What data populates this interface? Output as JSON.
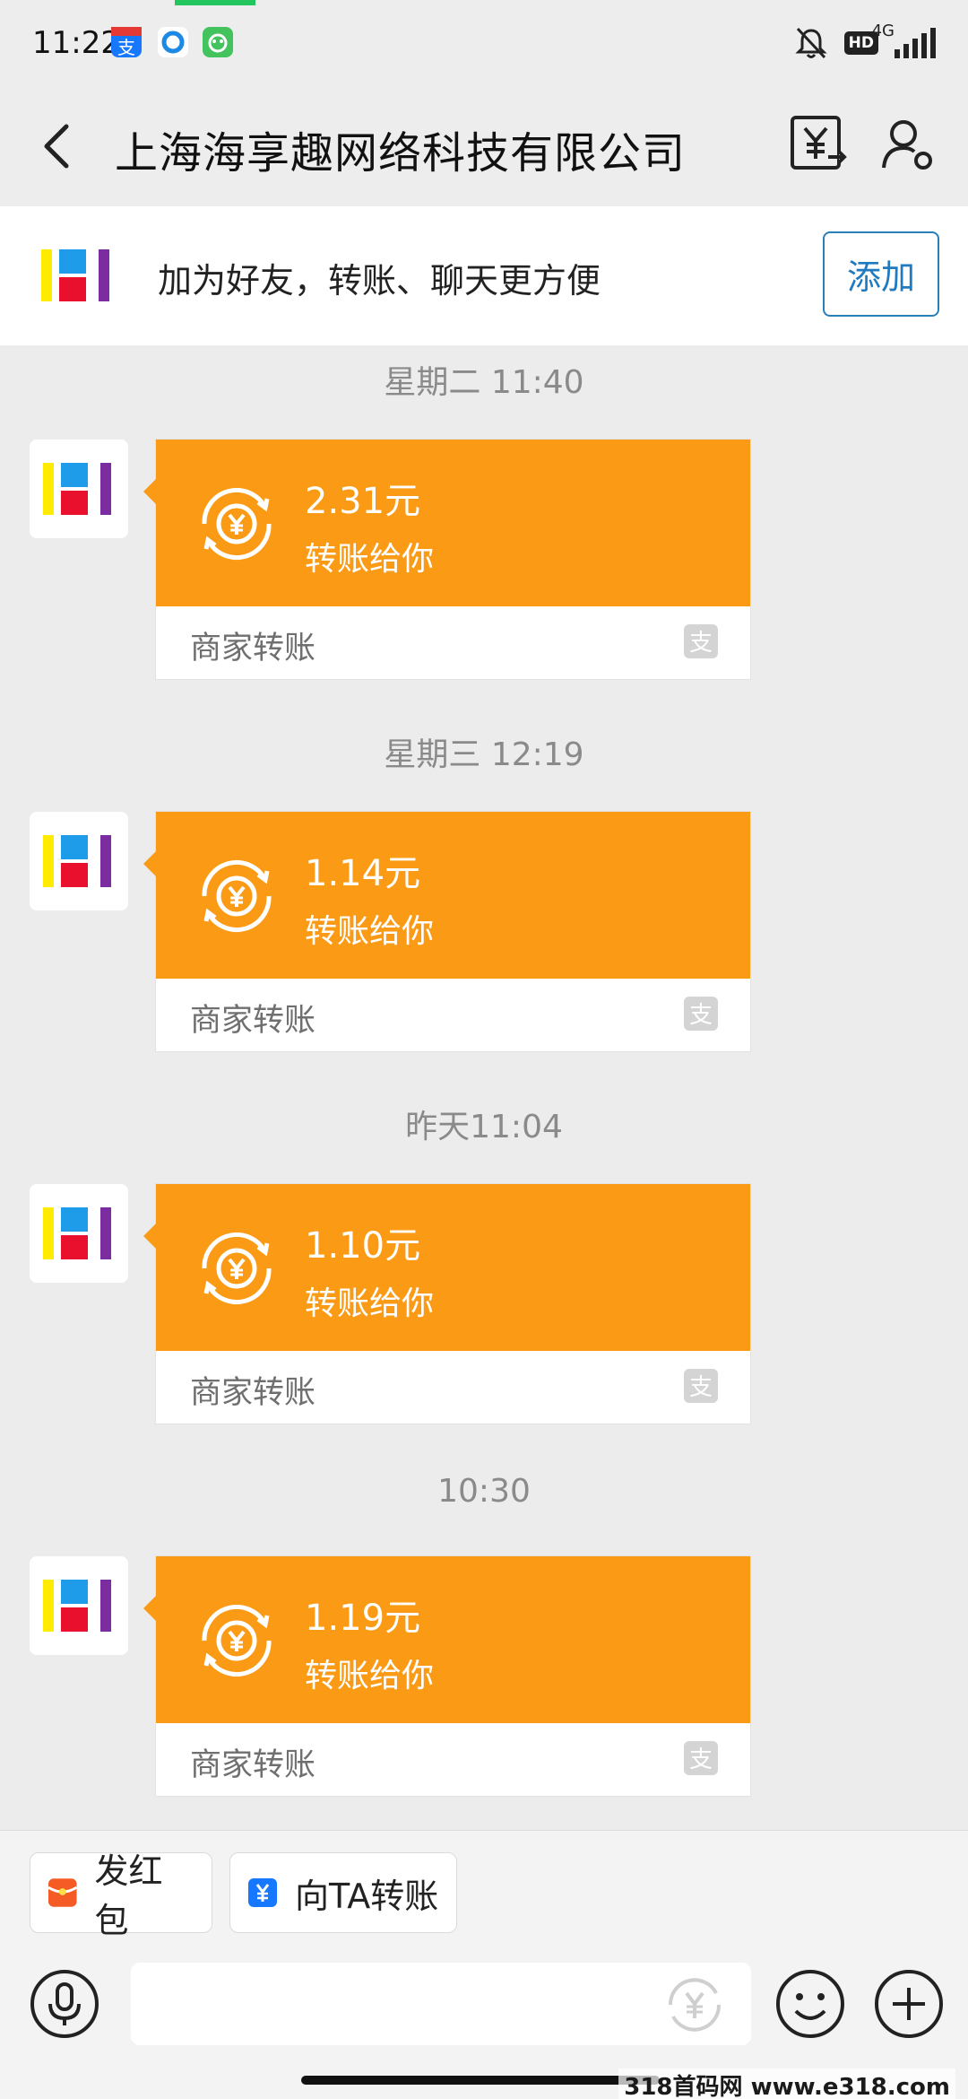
{
  "status_bar": {
    "time": "11:22",
    "network": "4G",
    "hd": "HD",
    "progress_color": "#22c55e"
  },
  "header": {
    "title": "上海海享趣网络科技有限公司",
    "back_icon": "chevron-left-icon",
    "bill_icon": "yuan-bill-icon",
    "profile_icon": "user-settings-icon"
  },
  "banner": {
    "text": "加为好友，转账、聊天更方便",
    "add_label": "添加"
  },
  "messages": [
    {
      "time": "星期二 11:40",
      "amount": "2.31元",
      "label": "转账给你",
      "merchant": "商家转账"
    },
    {
      "time": "星期三 12:19",
      "amount": "1.14元",
      "label": "转账给你",
      "merchant": "商家转账"
    },
    {
      "time": "昨天11:04",
      "amount": "1.10元",
      "label": "转账给你",
      "merchant": "商家转账"
    },
    {
      "time": "10:30",
      "amount": "1.19元",
      "label": "转账给你",
      "merchant": "商家转账"
    }
  ],
  "quick_actions": {
    "red_packet": "发红包",
    "transfer": "向TA转账"
  },
  "input": {
    "placeholder": ""
  },
  "watermark": "318首码网 www.e318.com",
  "colors": {
    "card_orange": "#fb9a14",
    "accent_blue": "#1f7ac0"
  }
}
